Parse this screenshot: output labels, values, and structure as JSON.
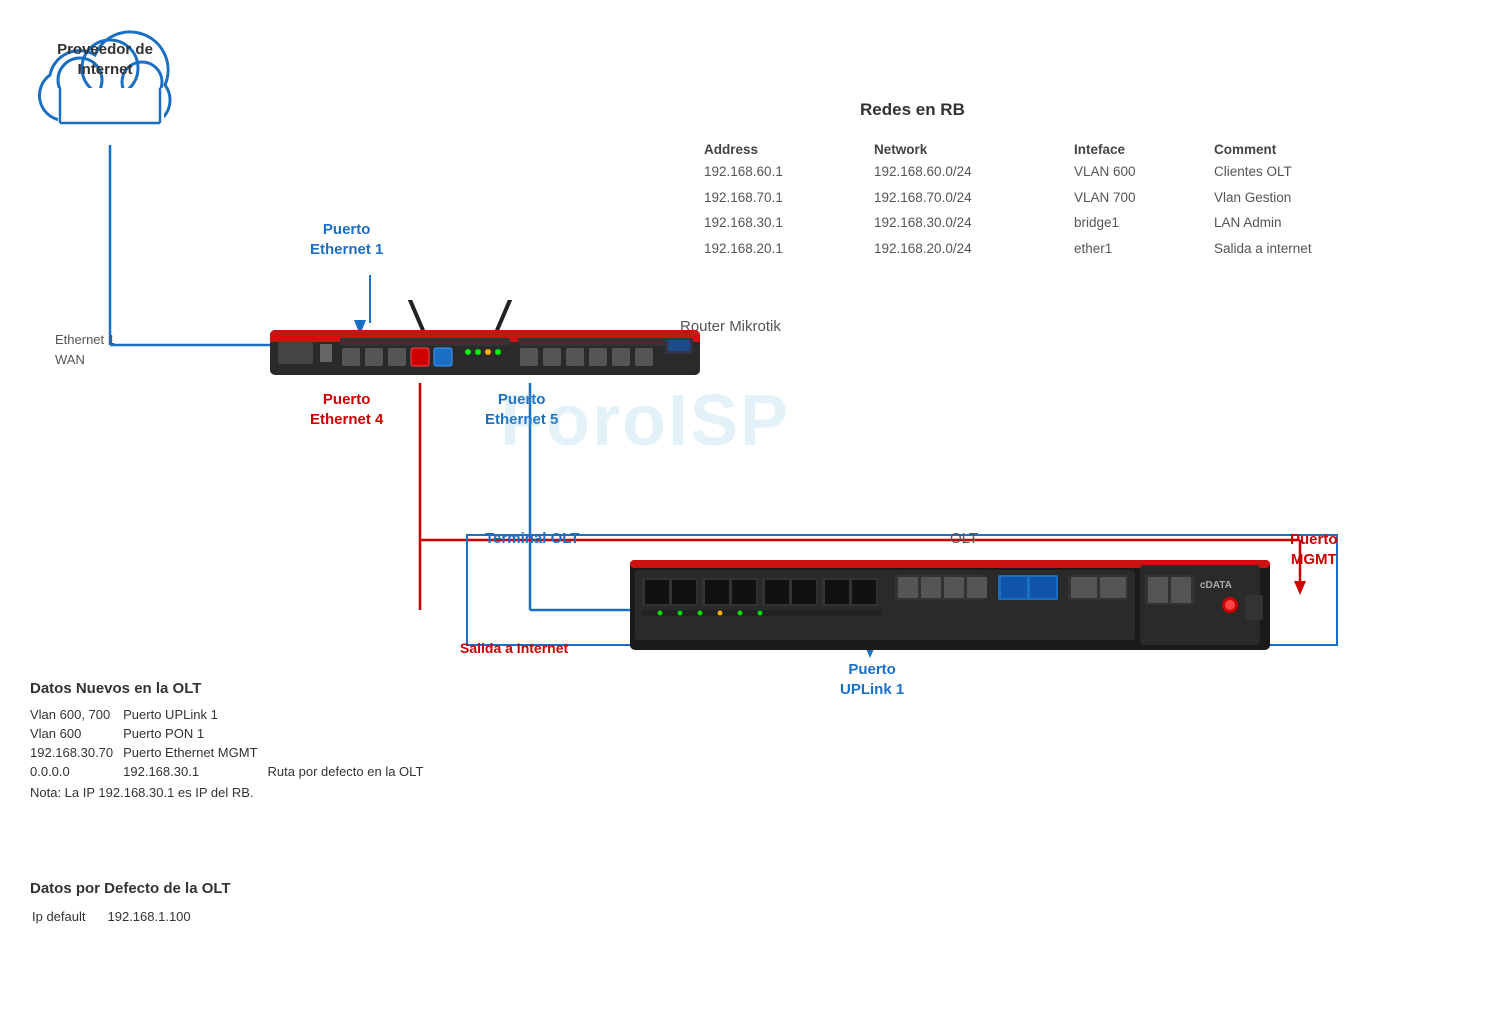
{
  "cloud": {
    "label_line1": "Proveedor de",
    "label_line2": "Internet"
  },
  "labels": {
    "eth1_wan_line1": "Ethernet 1",
    "eth1_wan_line2": "WAN",
    "puerto_eth1_line1": "Puerto",
    "puerto_eth1_line2": "Ethernet 1",
    "puerto_eth4_line1": "Puerto",
    "puerto_eth4_line2": "Ethernet 4",
    "puerto_eth5_line1": "Puerto",
    "puerto_eth5_line2": "Ethernet 5",
    "router_mikrotik": "Router Mikrotik",
    "terminal_olt": "Terminal OLT",
    "olt": "OLT",
    "puerto_mgmt_line1": "Puerto",
    "puerto_mgmt_line2": "MGMT",
    "salida_internet": "Salida a Internet",
    "puerto_uplink_line1": "Puerto",
    "puerto_uplink_line2": "UPLink 1"
  },
  "redes_rb": {
    "title": "Redes en RB",
    "headers": [
      "Address",
      "Network",
      "Inteface",
      "Comment"
    ],
    "rows": [
      [
        "192.168.60.1",
        "192.168.60.0/24",
        "VLAN 600",
        "Clientes OLT"
      ],
      [
        "192.168.70.1",
        "192.168.70.0/24",
        "VLAN 700",
        "Vlan Gestion"
      ],
      [
        "192.168.30.1",
        "192.168.30.0/24",
        "bridge1",
        "LAN Admin"
      ],
      [
        "192.168.20.1",
        "192.168.20.0/24",
        "ether1",
        "Salida a internet"
      ]
    ]
  },
  "datos_nuevos": {
    "title": "Datos Nuevos en  la OLT",
    "rows": [
      [
        "Vlan 600, 700",
        "Puerto UPLink 1",
        ""
      ],
      [
        "Vlan 600",
        "Puerto PON 1",
        ""
      ],
      [
        "192.168.30.70",
        "Puerto Ethernet MGMT",
        ""
      ],
      [
        "0.0.0.0",
        "192.168.30.1",
        "Ruta  por defecto en la OLT"
      ]
    ],
    "note": "Nota: La IP 192.168.30.1 es IP del RB."
  },
  "datos_defecto": {
    "title": "Datos por Defecto de la OLT",
    "rows": [
      [
        "Ip default",
        "192.168.1.100"
      ]
    ]
  },
  "watermark": "ForoISP"
}
